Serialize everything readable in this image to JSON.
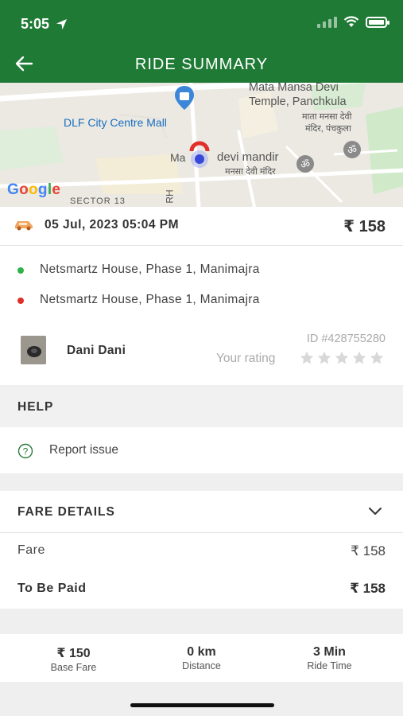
{
  "status_bar": {
    "time": "5:05"
  },
  "header": {
    "title": "RIDE SUMMARY"
  },
  "map": {
    "labels": {
      "dlf": "DLF City Centre Mall",
      "temple_en_1": "Mata Mansa Devi",
      "temple_en_2": "Temple, Panchkula",
      "temple_hi_1": "माता मनसा देवी",
      "temple_hi_2": "मंदिर, पंचकुला",
      "devi_mandir": "devi mandir",
      "devi_mandir_hi": "मनसा देवी मंदिर",
      "ma": "Ma",
      "sector": "SECTOR 13",
      "road": "RH",
      "google": "Google"
    }
  },
  "ride": {
    "date": "05 Jul, 2023 05:04 PM",
    "price": "₹ 158",
    "pickup": "Netsmartz House, Phase 1, Manimajra",
    "drop": "Netsmartz House, Phase 1, Manimajra",
    "driver_name": "Dani Dani",
    "ride_id": "ID #428755280",
    "rating_label": "Your rating",
    "rating_value": 0,
    "colors": {
      "pickup": "#2db34a",
      "drop": "#e0302a"
    }
  },
  "help": {
    "title": "HELP",
    "report_label": "Report issue"
  },
  "fare": {
    "title": "FARE DETAILS",
    "fare_label": "Fare",
    "fare_value": "₹ 158",
    "to_be_paid_label": "To Be Paid",
    "to_be_paid_value": "₹ 158"
  },
  "stats": [
    {
      "value": "₹ 150",
      "label": "Base Fare"
    },
    {
      "value": "0 km",
      "label": "Distance"
    },
    {
      "value": "3 Min",
      "label": "Ride Time"
    }
  ],
  "theme": {
    "accent": "#1f7a35"
  }
}
